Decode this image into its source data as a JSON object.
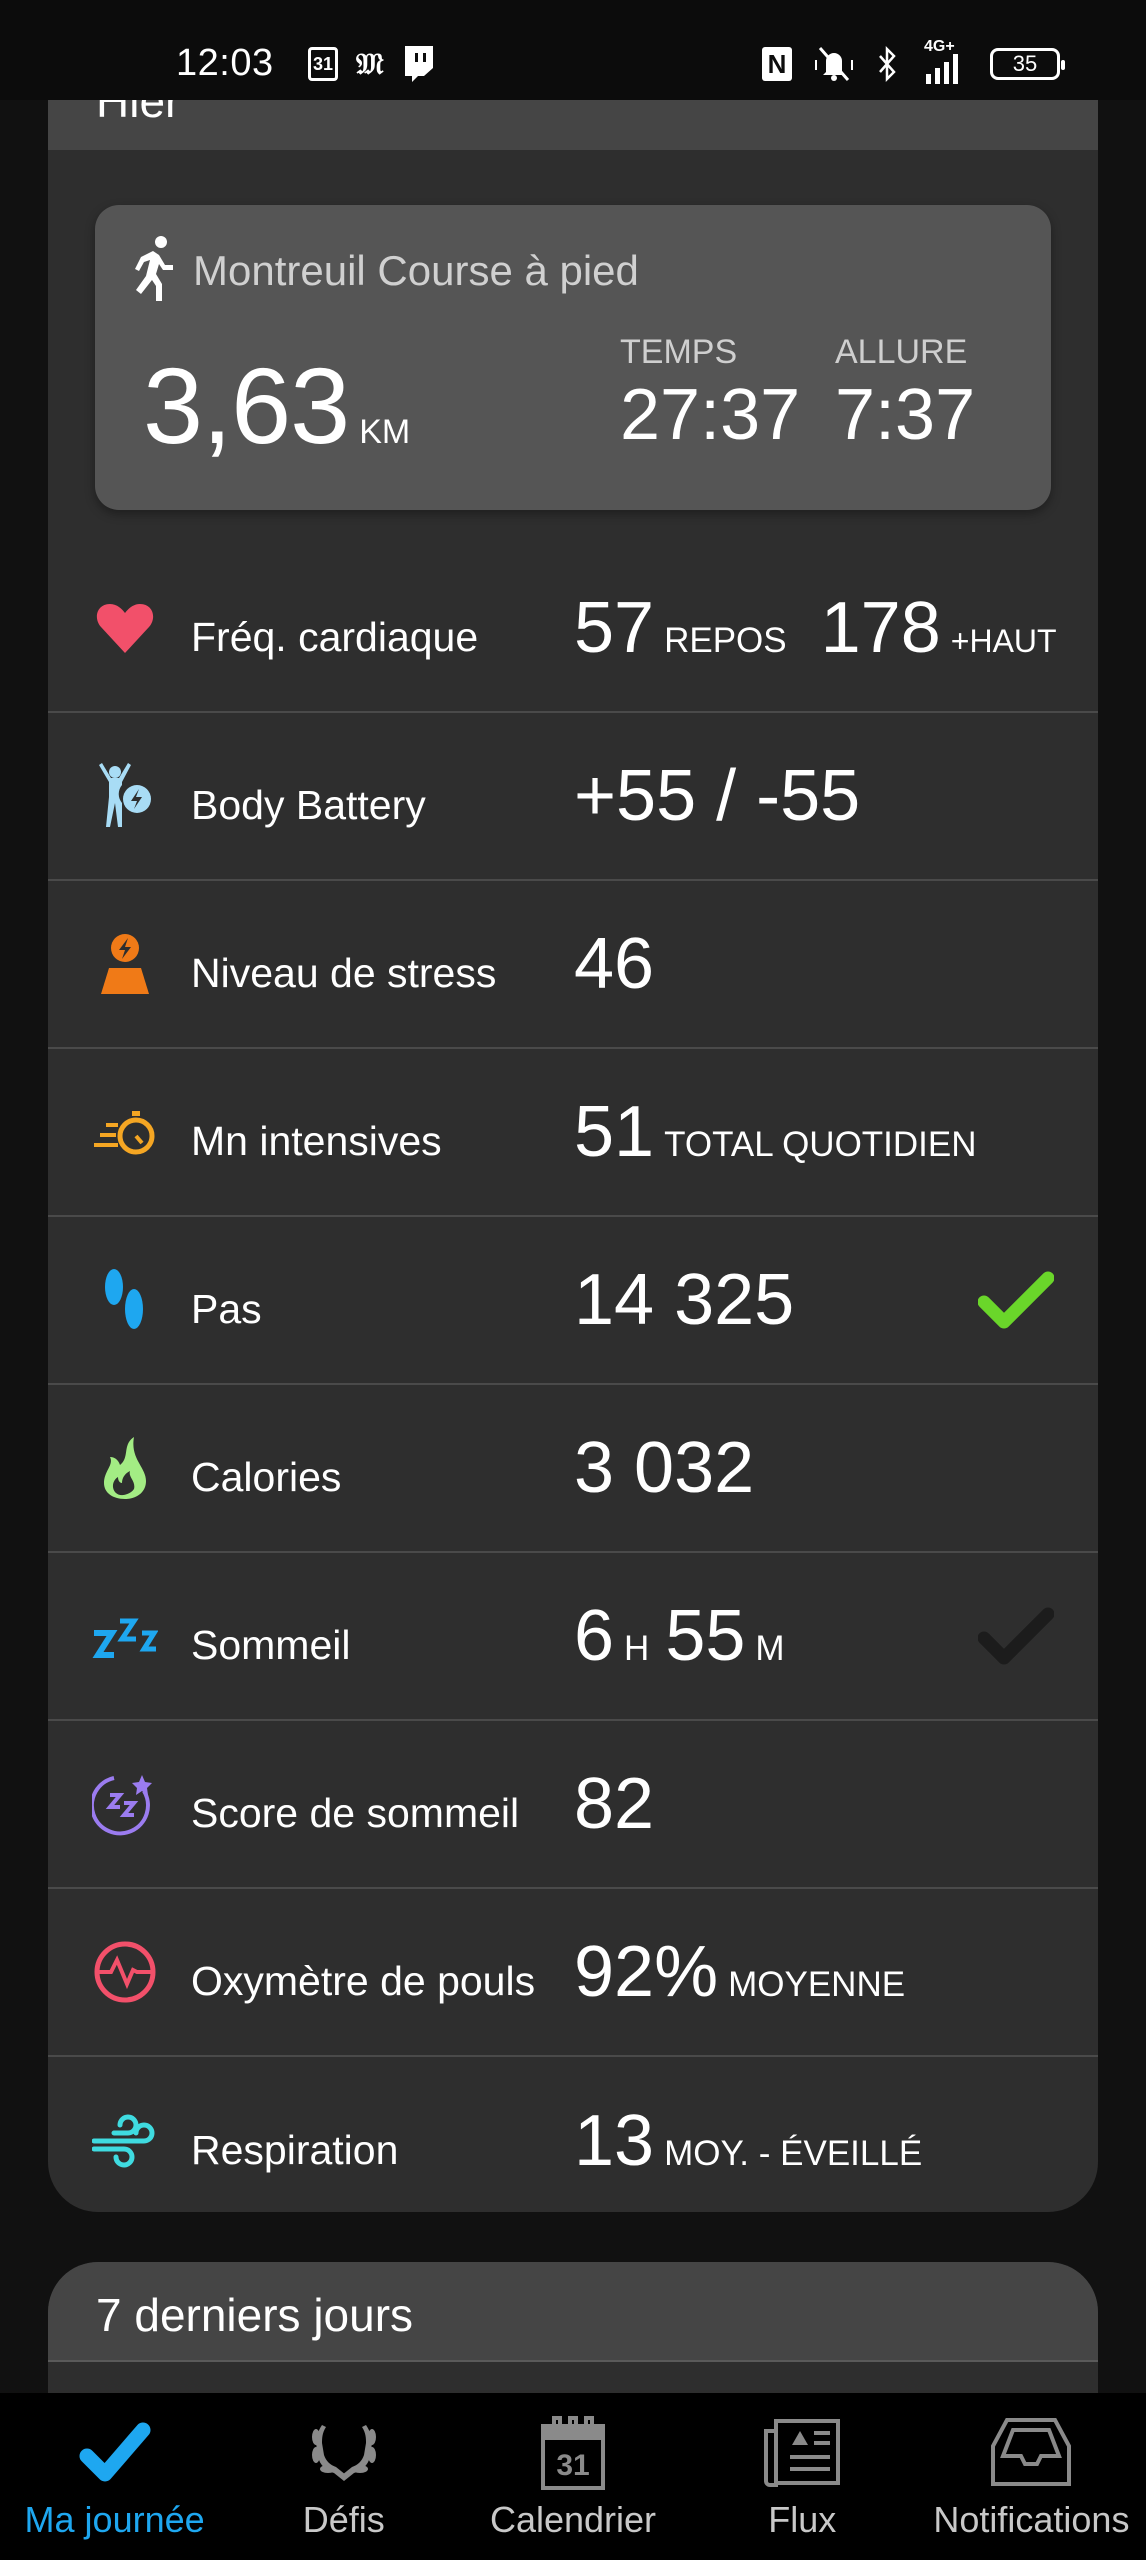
{
  "status_bar": {
    "time": "12:03",
    "calendar_date": "31",
    "battery_level": "35",
    "network": "4G+",
    "left_icons": [
      "calendar-icon",
      "le-monde-icon",
      "twitch-icon"
    ],
    "right_icons": [
      "nfc-icon",
      "vibrate-silent-icon",
      "bluetooth-icon",
      "signal-4g-icon",
      "battery-icon"
    ]
  },
  "day_card": {
    "title": "Hier",
    "activity": {
      "icon": "running-icon",
      "title": "Montreuil Course à pied",
      "distance_value": "3,63",
      "distance_unit": "KM",
      "time_label": "TEMPS",
      "time_value": "27:37",
      "pace_label": "ALLURE",
      "pace_value": "7:37"
    },
    "metrics": [
      {
        "icon": "heart-icon",
        "label": "Fréq. cardiaque",
        "value": "57",
        "unit": "REPOS",
        "value2": "178",
        "unit2": "+HAUT",
        "color": "#f2506a"
      },
      {
        "icon": "body-battery-icon",
        "label": "Body Battery",
        "value": "+55 / -55",
        "color": "#a8dcf5"
      },
      {
        "icon": "stress-icon",
        "label": "Niveau de stress",
        "value": "46",
        "color": "#f07a17"
      },
      {
        "icon": "stopwatch-icon",
        "label": "Mn intensives",
        "value": "51",
        "unit": "TOTAL QUOTIDIEN",
        "color": "#f5a623"
      },
      {
        "icon": "footsteps-icon",
        "label": "Pas",
        "value": "14 325",
        "goal_met": true,
        "color": "#1ea7f0",
        "check_color": "#6ad62a"
      },
      {
        "icon": "flame-icon",
        "label": "Calories",
        "value": "3 032",
        "color": "#a3ec84"
      },
      {
        "icon": "sleep-zzz-icon",
        "label": "Sommeil",
        "value_h": "6",
        "unit_h": "H",
        "value_m": "55",
        "unit_m": "M",
        "goal_met": false,
        "color": "#1ea7f0",
        "check_color": "#1c1c1c"
      },
      {
        "icon": "sleep-score-icon",
        "label": "Score de sommeil",
        "value": "82",
        "color": "#9b7cf0"
      },
      {
        "icon": "pulse-ox-icon",
        "label": "Oxymètre de pouls",
        "value": "92%",
        "unit": "MOYENNE",
        "color": "#f2506a"
      },
      {
        "icon": "wind-icon",
        "label": "Respiration",
        "value": "13",
        "unit": "MOY. - ÉVEILLÉ",
        "color": "#3fdbe0"
      }
    ]
  },
  "week_card": {
    "title": "7 derniers jours"
  },
  "bottom_nav": {
    "active_color": "#1ea7f0",
    "items": [
      {
        "icon": "checkmark-icon",
        "label": "Ma journée",
        "active": true
      },
      {
        "icon": "laurel-icon",
        "label": "Défis",
        "active": false
      },
      {
        "icon": "calendar-icon",
        "label": "Calendrier",
        "date": "31",
        "active": false
      },
      {
        "icon": "newspaper-icon",
        "label": "Flux",
        "active": false
      },
      {
        "icon": "inbox-icon",
        "label": "Notifications",
        "active": false
      }
    ]
  }
}
